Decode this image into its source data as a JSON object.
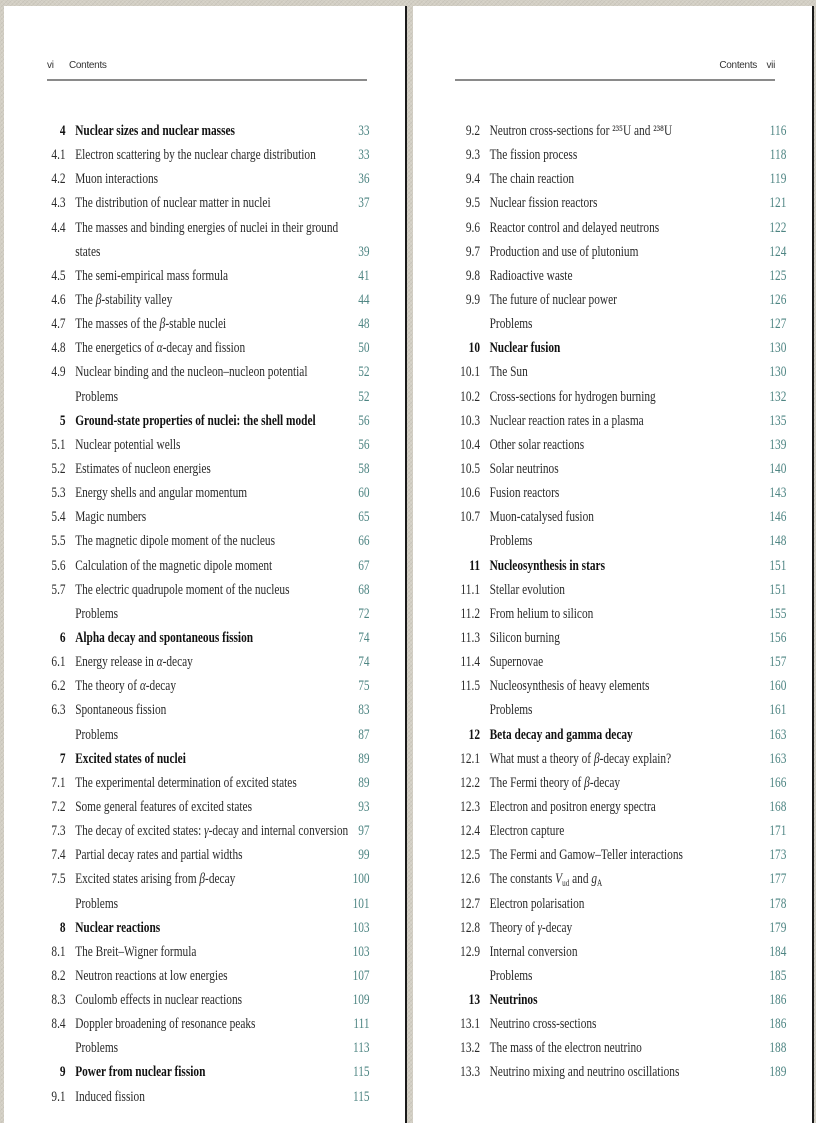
{
  "left_page": {
    "folio": "vi",
    "running_title": "Contents",
    "entries": [
      {
        "num": "4",
        "title": "Nuclear sizes and nuclear masses",
        "page": "33",
        "chapter": true
      },
      {
        "num": "4.1",
        "title": "Electron scattering by the nuclear charge distribution",
        "page": "33"
      },
      {
        "num": "4.2",
        "title": "Muon interactions",
        "page": "36"
      },
      {
        "num": "4.3",
        "title": "The distribution of nuclear matter in nuclei",
        "page": "37"
      },
      {
        "num": "4.4",
        "title": "The masses and binding energies of nuclei in their ground",
        "page": "",
        "wrap_first": true
      },
      {
        "num": "",
        "title": "states",
        "page": "39",
        "cont": true
      },
      {
        "num": "4.5",
        "title": "The semi-empirical mass formula",
        "page": "41"
      },
      {
        "num": "4.6",
        "title": "The β-stability valley",
        "page": "44"
      },
      {
        "num": "4.7",
        "title": "The masses of the β-stable nuclei",
        "page": "48"
      },
      {
        "num": "4.8",
        "title": "The energetics of α-decay and fission",
        "page": "50"
      },
      {
        "num": "4.9",
        "title": "Nuclear binding and the nucleon–nucleon potential",
        "page": "52"
      },
      {
        "num": "",
        "title": "Problems",
        "page": "52"
      },
      {
        "num": "5",
        "title": "Ground-state properties of nuclei: the shell model",
        "page": "56",
        "chapter": true
      },
      {
        "num": "5.1",
        "title": "Nuclear potential wells",
        "page": "56"
      },
      {
        "num": "5.2",
        "title": "Estimates of nucleon energies",
        "page": "58"
      },
      {
        "num": "5.3",
        "title": "Energy shells and angular momentum",
        "page": "60"
      },
      {
        "num": "5.4",
        "title": "Magic numbers",
        "page": "65"
      },
      {
        "num": "5.5",
        "title": "The magnetic dipole moment of the nucleus",
        "page": "66"
      },
      {
        "num": "5.6",
        "title": "Calculation of the magnetic dipole moment",
        "page": "67"
      },
      {
        "num": "5.7",
        "title": "The electric quadrupole moment of the nucleus",
        "page": "68"
      },
      {
        "num": "",
        "title": "Problems",
        "page": "72"
      },
      {
        "num": "6",
        "title": "Alpha decay and spontaneous fission",
        "page": "74",
        "chapter": true
      },
      {
        "num": "6.1",
        "title": "Energy release in α-decay",
        "page": "74"
      },
      {
        "num": "6.2",
        "title": "The theory of α-decay",
        "page": "75"
      },
      {
        "num": "6.3",
        "title": "Spontaneous fission",
        "page": "83"
      },
      {
        "num": "",
        "title": "Problems",
        "page": "87"
      },
      {
        "num": "7",
        "title": "Excited states of nuclei",
        "page": "89",
        "chapter": true
      },
      {
        "num": "7.1",
        "title": "The experimental determination of excited states",
        "page": "89"
      },
      {
        "num": "7.2",
        "title": "Some general features of excited states",
        "page": "93"
      },
      {
        "num": "7.3",
        "title": "The decay of excited states: γ-decay and internal conversion",
        "page": "97"
      },
      {
        "num": "7.4",
        "title": "Partial decay rates and partial widths",
        "page": "99"
      },
      {
        "num": "7.5",
        "title": "Excited states arising from β-decay",
        "page": "100"
      },
      {
        "num": "",
        "title": "Problems",
        "page": "101"
      },
      {
        "num": "8",
        "title": "Nuclear reactions",
        "page": "103",
        "chapter": true
      },
      {
        "num": "8.1",
        "title": "The Breit–Wigner formula",
        "page": "103"
      },
      {
        "num": "8.2",
        "title": "Neutron reactions at low energies",
        "page": "107"
      },
      {
        "num": "8.3",
        "title": "Coulomb effects in nuclear reactions",
        "page": "109"
      },
      {
        "num": "8.4",
        "title": "Doppler broadening of resonance peaks",
        "page": "111"
      },
      {
        "num": "",
        "title": "Problems",
        "page": "113"
      },
      {
        "num": "9",
        "title": "Power from nuclear fission",
        "page": "115",
        "chapter": true
      },
      {
        "num": "9.1",
        "title": "Induced fission",
        "page": "115"
      }
    ]
  },
  "right_page": {
    "folio": "vii",
    "running_title": "Contents",
    "entries": [
      {
        "num": "9.2",
        "title": "Neutron cross-sections for ²³⁵U and ²³⁸U",
        "page": "116"
      },
      {
        "num": "9.3",
        "title": "The fission process",
        "page": "118"
      },
      {
        "num": "9.4",
        "title": "The chain reaction",
        "page": "119"
      },
      {
        "num": "9.5",
        "title": "Nuclear fission reactors",
        "page": "121"
      },
      {
        "num": "9.6",
        "title": "Reactor control and delayed neutrons",
        "page": "122"
      },
      {
        "num": "9.7",
        "title": "Production and use of plutonium",
        "page": "124"
      },
      {
        "num": "9.8",
        "title": "Radioactive waste",
        "page": "125"
      },
      {
        "num": "9.9",
        "title": "The future of nuclear power",
        "page": "126"
      },
      {
        "num": "",
        "title": "Problems",
        "page": "127"
      },
      {
        "num": "10",
        "title": "Nuclear fusion",
        "page": "130",
        "chapter": true
      },
      {
        "num": "10.1",
        "title": "The Sun",
        "page": "130"
      },
      {
        "num": "10.2",
        "title": "Cross-sections for hydrogen burning",
        "page": "132"
      },
      {
        "num": "10.3",
        "title": "Nuclear reaction rates in a plasma",
        "page": "135"
      },
      {
        "num": "10.4",
        "title": "Other solar reactions",
        "page": "139"
      },
      {
        "num": "10.5",
        "title": "Solar neutrinos",
        "page": "140"
      },
      {
        "num": "10.6",
        "title": "Fusion reactors",
        "page": "143"
      },
      {
        "num": "10.7",
        "title": "Muon-catalysed fusion",
        "page": "146"
      },
      {
        "num": "",
        "title": "Problems",
        "page": "148"
      },
      {
        "num": "11",
        "title": "Nucleosynthesis in stars",
        "page": "151",
        "chapter": true
      },
      {
        "num": "11.1",
        "title": "Stellar evolution",
        "page": "151"
      },
      {
        "num": "11.2",
        "title": "From helium to silicon",
        "page": "155"
      },
      {
        "num": "11.3",
        "title": "Silicon burning",
        "page": "156"
      },
      {
        "num": "11.4",
        "title": "Supernovae",
        "page": "157"
      },
      {
        "num": "11.5",
        "title": "Nucleosynthesis of heavy elements",
        "page": "160"
      },
      {
        "num": "",
        "title": "Problems",
        "page": "161"
      },
      {
        "num": "12",
        "title": "Beta decay and gamma decay",
        "page": "163",
        "chapter": true
      },
      {
        "num": "12.1",
        "title": "What must a theory of β-decay explain?",
        "page": "163"
      },
      {
        "num": "12.2",
        "title": "The Fermi theory of β-decay",
        "page": "166"
      },
      {
        "num": "12.3",
        "title": "Electron and positron energy spectra",
        "page": "168"
      },
      {
        "num": "12.4",
        "title": "Electron capture",
        "page": "171"
      },
      {
        "num": "12.5",
        "title": "The Fermi and Gamow–Teller interactions",
        "page": "173"
      },
      {
        "num": "12.6",
        "title": "The constants V_ud and g_A",
        "page": "177"
      },
      {
        "num": "12.7",
        "title": "Electron polarisation",
        "page": "178"
      },
      {
        "num": "12.8",
        "title": "Theory of γ-decay",
        "page": "179"
      },
      {
        "num": "12.9",
        "title": "Internal conversion",
        "page": "184"
      },
      {
        "num": "",
        "title": "Problems",
        "page": "185"
      },
      {
        "num": "13",
        "title": "Neutrinos",
        "page": "186",
        "chapter": true
      },
      {
        "num": "13.1",
        "title": "Neutrino cross-sections",
        "page": "186"
      },
      {
        "num": "13.2",
        "title": "The mass of the electron neutrino",
        "page": "188"
      },
      {
        "num": "13.3",
        "title": "Neutrino mixing and neutrino oscillations",
        "page": "189"
      }
    ]
  },
  "colors": {
    "page_number": "#4e8583",
    "text": "#2a2a2a",
    "chapter_text": "#111111",
    "background": "#d3cfc4",
    "page": "#ffffff"
  }
}
